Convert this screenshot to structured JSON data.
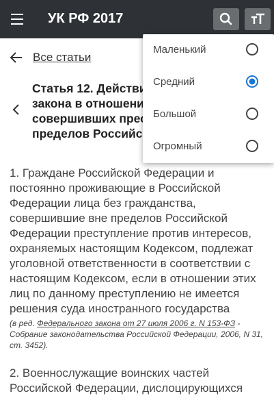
{
  "app": {
    "title": "УК РФ 2017"
  },
  "nav": {
    "back_label": "Все статьи"
  },
  "article": {
    "title": "Статья 12. Действие уголовного закона в отношении лиц, совершивших преступление вне пределов Российской Федерации",
    "paragraph1": "1. Граждане Российской Федерации и постоянно проживающие в Российской Федерации лица без гражданства, совершившие вне пределов Российской Федерации преступление против интересов, охраняемых настоящим Кодексом, подлежат уголовной ответственности в соответствии с настоящим Кодексом, если в отношении этих лиц по данному преступлению не имеется решения суда иностранного государства",
    "ref_prefix": "(в ред. ",
    "ref_link": "Федерального закона от 27 июля 2006 г. N 153-ФЗ",
    "ref_suffix": " - Собрание законодательства Российской Федерации, 2006, N 31, ст. 3452).",
    "paragraph2": "2. Военнослужащие воинских частей Российской Федерации, дислоцирующихся"
  },
  "text_size_menu": {
    "options": [
      {
        "label": "Маленький",
        "selected": false
      },
      {
        "label": "Средний",
        "selected": true
      },
      {
        "label": "Большой",
        "selected": false
      },
      {
        "label": "Огромный",
        "selected": false
      }
    ]
  },
  "colors": {
    "appbar": "#2e3236",
    "button": "#6a6d70",
    "accent": "#1976d2"
  },
  "icons": {
    "menu": "hamburger-icon",
    "search": "search-icon",
    "text_size": "text-size-icon",
    "back": "arrow-left-icon",
    "prev": "chevron-left-icon"
  }
}
